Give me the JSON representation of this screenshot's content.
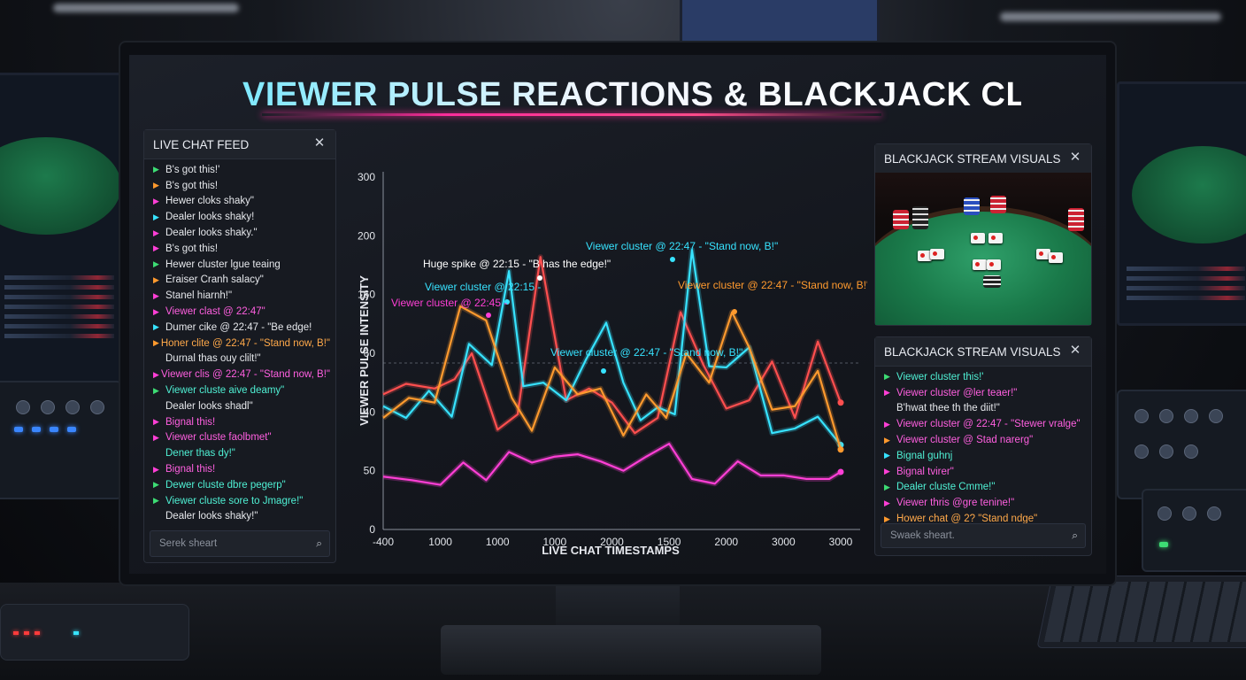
{
  "title": "VIEWER PULSE REACTIONS & BLACKJACK CLUES FOR B",
  "colors": {
    "magenta": "#ff3fd6",
    "cyan": "#37e3ff",
    "orange": "#ff9a2e",
    "red": "#ff4f4f",
    "green": "#3ddc74",
    "teal": "#3fd9c5"
  },
  "chat_panel": {
    "title": "LIVE CHAT FEED",
    "close_icon": "close-icon",
    "search_placeholder": "Serek sheart",
    "messages": [
      {
        "text": "B's got this!'",
        "arrow_color": "#3ddc74",
        "text_color": "#e6e8ec"
      },
      {
        "text": "B's got this!",
        "arrow_color": "#ff9a2e",
        "text_color": "#e6e8ec"
      },
      {
        "text": "Hewer cloks shaky\"",
        "arrow_color": "#ff3fd6",
        "text_color": "#e6e8ec"
      },
      {
        "text": "Dealer looks shaky!",
        "arrow_color": "#37e3ff",
        "text_color": "#e6e8ec"
      },
      {
        "text": "Dealer looks shaky.\"",
        "arrow_color": "#ff3fd6",
        "text_color": "#e6e8ec"
      },
      {
        "text": "B's got this!",
        "arrow_color": "#ff3fd6",
        "text_color": "#e6e8ec"
      },
      {
        "text": "Hewer cluster lgue teaing",
        "arrow_color": "#3ddc74",
        "text_color": "#e6e8ec"
      },
      {
        "text": "Eraiser Cranh salacy\"",
        "arrow_color": "#ff9a2e",
        "text_color": "#e6e8ec"
      },
      {
        "text": "Stanel hiarnh!\"",
        "arrow_color": "#ff3fd6",
        "text_color": "#e6e8ec"
      },
      {
        "text": "Viewer clast @ 22:47\"",
        "arrow_color": "#ff3fd6",
        "text_color": "#ff5fe0"
      },
      {
        "text": "Dumer cike @ 22:47 - \"Be edge!",
        "arrow_color": "#37e3ff",
        "text_color": "#e6e8ec"
      },
      {
        "text": "Honer clite @ 22:47 - \"Stand now, B!\"",
        "arrow_color": "#ff9a2e",
        "text_color": "#ffa94a"
      },
      {
        "text": "Durnal thas ouy clilt!\"",
        "arrow_color": "",
        "text_color": "#e6e8ec"
      },
      {
        "text": "Viewer clis @ 22:47 - \"Stand now, B!\"",
        "arrow_color": "#ff3fd6",
        "text_color": "#ff5fe0"
      },
      {
        "text": "Viewer cluste aive deamy\"",
        "arrow_color": "#3ddc74",
        "text_color": "#4ff0d4"
      },
      {
        "text": "Dealer looks shadl\"",
        "arrow_color": "",
        "text_color": "#e6e8ec"
      },
      {
        "text": "Bignal this!",
        "arrow_color": "#ff3fd6",
        "text_color": "#ff5fe0"
      },
      {
        "text": "Viewer cluste faolbmet\"",
        "arrow_color": "#ff3fd6",
        "text_color": "#ff5fe0"
      },
      {
        "text": "Dener thas dy!\"",
        "arrow_color": "",
        "text_color": "#4ff0d4"
      },
      {
        "text": "Bignal this!",
        "arrow_color": "#ff3fd6",
        "text_color": "#ff5fe0"
      },
      {
        "text": "Dewer cluste dbre pegerp\"",
        "arrow_color": "#3ddc74",
        "text_color": "#4ff0d4"
      },
      {
        "text": "Viewer cluste sore to Jmagre!\"",
        "arrow_color": "#3ddc74",
        "text_color": "#4ff0d4"
      },
      {
        "text": "Dealer looks shaky!\"",
        "arrow_color": "",
        "text_color": "#e6e8ec"
      }
    ]
  },
  "visuals_panel": {
    "title": "BLACKJACK STREAM VISUALS",
    "close_icon": "close-icon"
  },
  "visuals_chat_panel": {
    "title": "BLACKJACK STREAM VISUALS",
    "close_icon": "close-icon",
    "search_placeholder": "Swaek sheart.",
    "messages": [
      {
        "text": "Viewer cluster this!'",
        "arrow_color": "#3ddc74",
        "text_color": "#4ff0d4"
      },
      {
        "text": "Viewer cluster @ler teaer!\"",
        "arrow_color": "#ff3fd6",
        "text_color": "#ff5fe0"
      },
      {
        "text": "B'hwat thee th the diit!\"",
        "arrow_color": "",
        "text_color": "#e6e8ec"
      },
      {
        "text": "Viewer cluster @ 22:47 - \"Stewer vralge\"",
        "arrow_color": "#ff3fd6",
        "text_color": "#ff5fe0"
      },
      {
        "text": "Viewer cluster @ Stad narerg\"",
        "arrow_color": "#ff9a2e",
        "text_color": "#ff5fe0"
      },
      {
        "text": "Bignal guhnj",
        "arrow_color": "#37e3ff",
        "text_color": "#4ff0d4"
      },
      {
        "text": "Bignal tvirer\"",
        "arrow_color": "#ff3fd6",
        "text_color": "#ff5fe0"
      },
      {
        "text": "Dealer cluste Cmme!\"",
        "arrow_color": "#3ddc74",
        "text_color": "#4ff0d4"
      },
      {
        "text": "Viewer thris @gre tenine!\"",
        "arrow_color": "#ff3fd6",
        "text_color": "#ff5fe0"
      },
      {
        "text": "Hower chat @ 2? \"Stand ndge\"",
        "arrow_color": "#ff9a2e",
        "text_color": "#ffa94a"
      }
    ]
  },
  "chart_data": {
    "type": "line",
    "xlabel": "LIVE CHAT TIMESTAMPS",
    "ylabel": "VIEWER PULSE INTENSITY",
    "x_tick_labels": [
      "-400",
      "1000",
      "1000",
      "1000",
      "2000",
      "1500",
      "2000",
      "3000",
      "3000"
    ],
    "y_tick_labels": [
      "0",
      "50",
      "40",
      "60",
      "160",
      "200",
      "300"
    ],
    "x_tick_positions": [
      0,
      1,
      2,
      3,
      4,
      5,
      6,
      7,
      8
    ],
    "ylim": [
      0,
      300
    ],
    "grid": false,
    "series": [
      {
        "color": "#ff3fd6",
        "x": [
          0,
          0.5,
          1,
          1.4,
          1.8,
          2.2,
          2.6,
          3.0,
          3.4,
          3.8,
          4.2,
          4.6,
          5.0,
          5.4,
          5.8,
          6.2,
          6.6,
          7.0,
          7.4,
          7.8,
          8.0
        ],
        "y": [
          45,
          42,
          38,
          57,
          42,
          66,
          57,
          62,
          64,
          58,
          50,
          62,
          73,
          43,
          39,
          58,
          46,
          46,
          43,
          43,
          49
        ]
      },
      {
        "color": "#ff4f4f",
        "x": [
          0,
          0.4,
          0.9,
          1.25,
          1.55,
          2.0,
          2.35,
          2.75,
          3.2,
          3.6,
          4.0,
          4.4,
          4.8,
          5.2,
          5.6,
          6.0,
          6.4,
          6.8,
          7.2,
          7.6,
          8.0
        ],
        "y": [
          115,
          124,
          120,
          128,
          150,
          85,
          98,
          232,
          110,
          120,
          108,
          82,
          95,
          185,
          140,
          103,
          110,
          143,
          95,
          160,
          108
        ]
      },
      {
        "color": "#37e3ff",
        "x": [
          0,
          0.4,
          0.8,
          1.2,
          1.5,
          1.9,
          2.2,
          2.45,
          2.8,
          3.2,
          3.55,
          3.9,
          4.2,
          4.5,
          4.8,
          5.1,
          5.4,
          5.7,
          6.0,
          6.4,
          6.8,
          7.2,
          7.6,
          8.0
        ],
        "y": [
          105,
          95,
          118,
          96,
          158,
          140,
          220,
          122,
          125,
          110,
          145,
          176,
          125,
          93,
          104,
          98,
          238,
          139,
          138,
          155,
          82,
          86,
          96,
          72
        ]
      },
      {
        "color": "#ff9a2e",
        "x": [
          0,
          0.45,
          0.9,
          1.35,
          1.8,
          2.25,
          2.6,
          3.0,
          3.4,
          3.8,
          4.2,
          4.6,
          4.95,
          5.3,
          5.7,
          6.1,
          6.4,
          6.8,
          7.2,
          7.6,
          8.0
        ],
        "y": [
          95,
          112,
          108,
          190,
          178,
          112,
          84,
          138,
          115,
          120,
          80,
          115,
          95,
          150,
          125,
          185,
          155,
          102,
          105,
          135,
          68
        ]
      }
    ],
    "annotations": [
      {
        "text": "Huge spike @ 22:15 - \"B has the edge!\"",
        "color": "#ffffff"
      },
      {
        "text": "Viewer cluster @ 22:15 -",
        "color": "#37e3ff"
      },
      {
        "text": "Viewer cluster @ 22:45 -",
        "color": "#ff3fd6"
      },
      {
        "text": "Viewer cluster @ 22:47 - \"Stand now, B!\"",
        "color": "#37e3ff"
      },
      {
        "text": "Viewer cluster @ 22:47 - \"Stand now, B!\"",
        "color": "#37e3ff"
      },
      {
        "text": "Viewer cluster @ 22:47 - \"Stand now, B!\"",
        "color": "#ff9a2e"
      }
    ]
  }
}
